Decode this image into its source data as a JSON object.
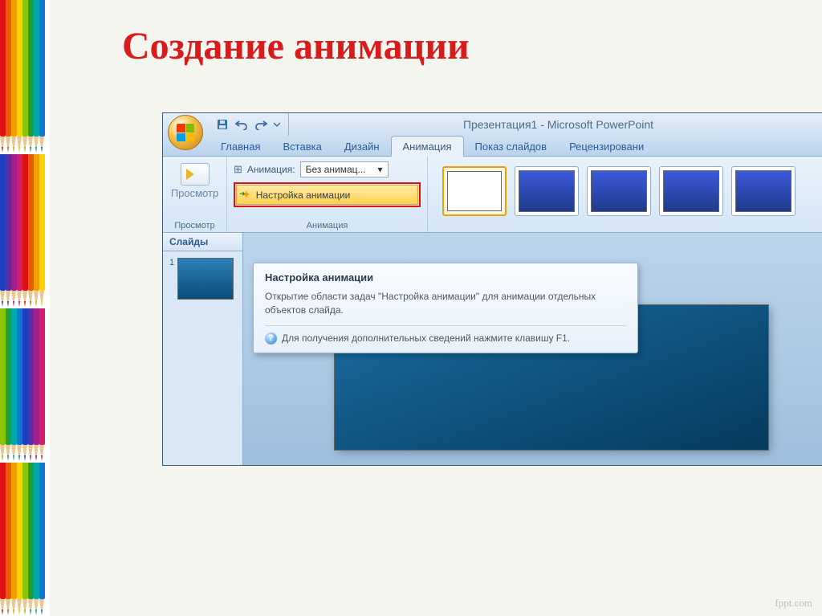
{
  "slide_title": "Создание анимации",
  "window_title": "Презентация1 - Microsoft PowerPoint",
  "tabs": {
    "home": "Главная",
    "insert": "Вставка",
    "design": "Дизайн",
    "animation": "Анимация",
    "slideshow": "Показ слайдов",
    "review": "Рецензировани"
  },
  "ribbon": {
    "preview_group": "Просмотр",
    "preview_btn": "Просмотр",
    "anim_group": "Анимация",
    "anim_label": "Анимация:",
    "anim_value": "Без анимац...",
    "anim_settings": "Настройка анимации"
  },
  "slides_pane": {
    "tab": "Слайды",
    "num": "1"
  },
  "tooltip": {
    "title": "Настройка анимации",
    "body": "Открытие области задач \"Настройка анимации\" для анимации отдельных объектов слайда.",
    "help": "Для получения дополнительных сведений нажмите клавишу F1."
  },
  "watermark": "fppt.com",
  "pencil_colors": [
    "#d11",
    "#e65c00",
    "#f0a000",
    "#f7d500",
    "#8bc500",
    "#1f9e3b",
    "#0aa",
    "#0a78d4",
    "#1b3fbf",
    "#5a2ea6",
    "#a11e8c",
    "#d11f6a",
    "#d11",
    "#e65c00",
    "#f0a000",
    "#f7d500",
    "#8bc500",
    "#1f9e3b",
    "#0aa",
    "#0a78d4",
    "#1b3fbf",
    "#5a2ea6",
    "#a11e8c",
    "#d11f6a",
    "#d11",
    "#e65c00",
    "#f0a000",
    "#f7d500",
    "#8bc500",
    "#1f9e3b",
    "#0aa",
    "#0a78d4"
  ]
}
